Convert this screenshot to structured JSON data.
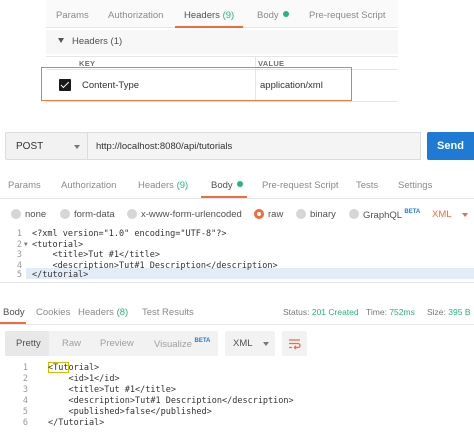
{
  "top_panel": {
    "tabs": [
      {
        "label": "Params"
      },
      {
        "label": "Authorization"
      },
      {
        "label": "Headers",
        "count": "(9)"
      },
      {
        "label": "Body"
      },
      {
        "label": "Pre-request Script"
      }
    ],
    "headers_section_title": "Headers (1)",
    "columns": {
      "key": "KEY",
      "value": "VALUE"
    },
    "row": {
      "checked": true,
      "key": "Content-Type",
      "value": "application/xml"
    }
  },
  "request": {
    "method": "POST",
    "url": "http://localhost:8080/api/tutorials",
    "send_label": "Send"
  },
  "request_tabs": [
    {
      "label": "Params"
    },
    {
      "label": "Authorization"
    },
    {
      "label": "Headers",
      "count": "(9)"
    },
    {
      "label": "Body"
    },
    {
      "label": "Pre-request Script"
    },
    {
      "label": "Tests"
    },
    {
      "label": "Settings"
    }
  ],
  "body_types": [
    {
      "label": "none"
    },
    {
      "label": "form-data"
    },
    {
      "label": "x-www-form-urlencoded"
    },
    {
      "label": "raw"
    },
    {
      "label": "binary"
    },
    {
      "label": "GraphQL",
      "badge": "BETA"
    }
  ],
  "body_format": "XML",
  "request_code": [
    {
      "n": "1",
      "text": "<?xml version=\"1.0\" encoding=\"UTF-8\"?>"
    },
    {
      "n": "2",
      "text": "<tutorial>"
    },
    {
      "n": "3",
      "text": "    <title>Tut #1</title>"
    },
    {
      "n": "4",
      "text": "    <description>Tut#1 Description</description>"
    },
    {
      "n": "5",
      "text": "</tutorial>"
    }
  ],
  "response_tabs": [
    {
      "label": "Body"
    },
    {
      "label": "Cookies"
    },
    {
      "label": "Headers",
      "count": "(8)"
    },
    {
      "label": "Test Results"
    }
  ],
  "response_status": {
    "status_label": "Status:",
    "status_value": "201 Created",
    "time_label": "Time:",
    "time_value": "752ms",
    "size_label": "Size:",
    "size_value": "395 B"
  },
  "response_views": [
    {
      "label": "Pretty"
    },
    {
      "label": "Raw"
    },
    {
      "label": "Preview"
    },
    {
      "label": "Visualize",
      "badge": "BETA"
    }
  ],
  "response_format": "XML",
  "response_code": [
    {
      "n": "1",
      "text": "<Tutorial>"
    },
    {
      "n": "2",
      "text": "    <id>1</id>"
    },
    {
      "n": "3",
      "text": "    <title>Tut #1</title>"
    },
    {
      "n": "4",
      "text": "    <description>Tut#1 Description</description>"
    },
    {
      "n": "5",
      "text": "    <published>false</published>"
    },
    {
      "n": "6",
      "text": "</Tutorial>"
    }
  ],
  "colors": {
    "accent": "#f26b3a",
    "send": "#1f7ad6",
    "success": "#26b47f"
  }
}
